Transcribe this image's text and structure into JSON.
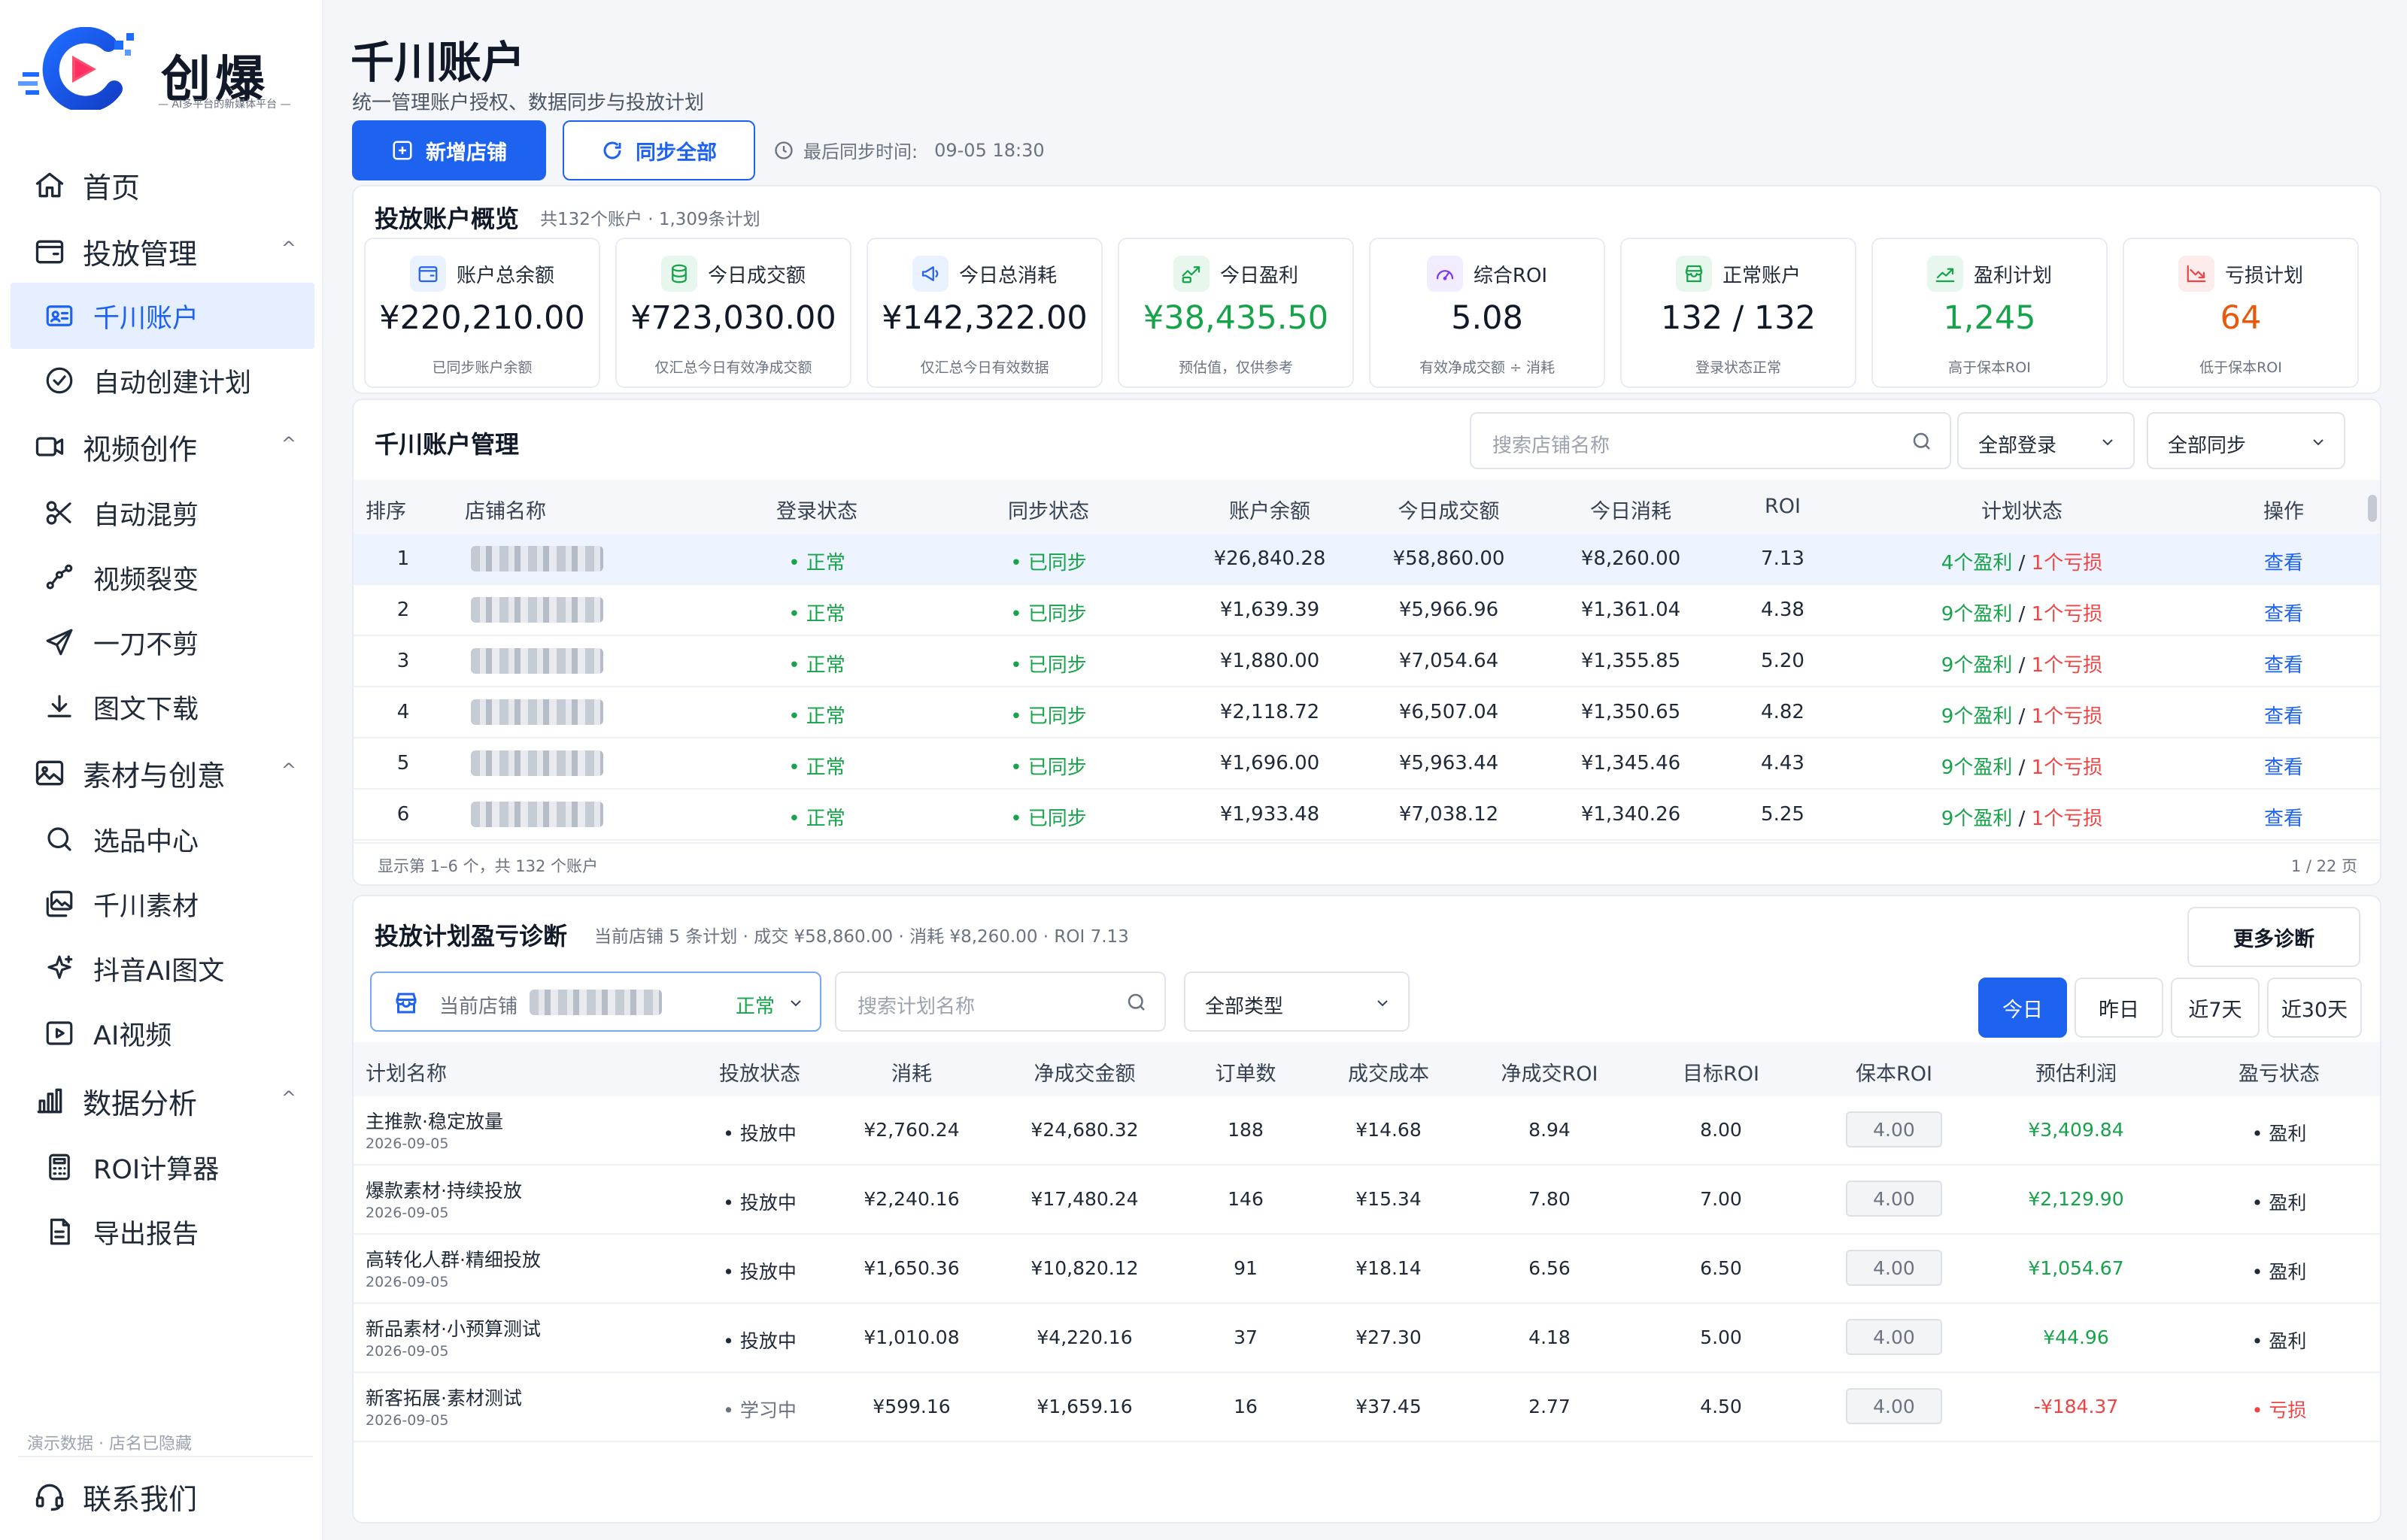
{
  "brand": {
    "name": "创爆",
    "slogan": "— AI多平台的新媒体平台 —"
  },
  "sidebar": {
    "items": [
      {
        "label": "首页",
        "icon": "home-icon"
      },
      {
        "label": "投放管理",
        "icon": "wallet-icon",
        "arrow": "^"
      },
      {
        "label": "千川账户",
        "icon": "account-card-icon",
        "active": true
      },
      {
        "label": "自动创建计划",
        "icon": "check-circle-icon"
      },
      {
        "label": "视频创作",
        "icon": "video-camera-icon",
        "arrow": "^"
      },
      {
        "label": "自动混剪",
        "icon": "scissors-icon"
      },
      {
        "label": "视频裂变",
        "icon": "fork-icon"
      },
      {
        "label": "一刀不剪",
        "icon": "send-icon"
      },
      {
        "label": "图文下载",
        "icon": "download-icon"
      },
      {
        "label": "素材与创意",
        "icon": "image-icon",
        "arrow": "^"
      },
      {
        "label": "选品中心",
        "icon": "search-icon"
      },
      {
        "label": "千川素材",
        "icon": "images-icon"
      },
      {
        "label": "抖音AI图文",
        "icon": "sparkle-icon"
      },
      {
        "label": "AI视频",
        "icon": "play-box-icon"
      },
      {
        "label": "数据分析",
        "icon": "bar-chart-icon",
        "arrow": "^"
      },
      {
        "label": "ROI计算器",
        "icon": "calculator-icon"
      },
      {
        "label": "导出报告",
        "icon": "file-icon"
      }
    ],
    "note": "演示数据 · 店名已隐藏",
    "contact": "联系我们"
  },
  "header": {
    "title": "千川账户",
    "subtitle": "统一管理账户授权、数据同步与投放计划",
    "add_button": "新增店铺",
    "sync_button": "同步全部",
    "sync_label": "最后同步时间:",
    "sync_time": "09-05 18:30"
  },
  "overview": {
    "title": "投放账户概览",
    "meta": "共132个账户 · 1,309条计划",
    "stats": [
      {
        "label": "账户总余额",
        "value": "¥220,210.00",
        "hint": "已同步账户余额",
        "icon": "wallet-icon",
        "color": "#2563eb",
        "bg": "#eaf1ff"
      },
      {
        "label": "今日成交额",
        "value": "¥723,030.00",
        "hint": "仅汇总今日有效净成交额",
        "icon": "coins-icon",
        "color": "#16a34a",
        "bg": "#e7f7ee"
      },
      {
        "label": "今日总消耗",
        "value": "¥142,322.00",
        "hint": "仅汇总今日有效数据",
        "icon": "megaphone-icon",
        "color": "#2563eb",
        "bg": "#eaf1ff"
      },
      {
        "label": "今日盈利",
        "value": "¥38,435.50",
        "hint": "预估值，仅供参考",
        "icon": "money-icon",
        "color": "#16a34a",
        "bg": "#e7f7ee",
        "valueColor": "#16a34a"
      },
      {
        "label": "综合ROI",
        "value": "5.08",
        "hint": "有效净成交额 ÷ 消耗",
        "icon": "gauge-icon",
        "color": "#7c3aed",
        "bg": "#f1ecff"
      },
      {
        "label": "正常账户",
        "value": "132 / 132",
        "hint": "登录状态正常",
        "icon": "store-icon",
        "color": "#16a34a",
        "bg": "#e7f7ee"
      },
      {
        "label": "盈利计划",
        "value": "1,245",
        "hint": "高于保本ROI",
        "icon": "trend-up-icon",
        "color": "#16a34a",
        "bg": "#e7f7ee",
        "valueColor": "#16a34a"
      },
      {
        "label": "亏损计划",
        "value": "64",
        "hint": "低于保本ROI",
        "icon": "trend-down-icon",
        "color": "#ef4444",
        "bg": "#fdecec",
        "valueColor": "#ea580c"
      }
    ]
  },
  "accounts": {
    "title": "千川账户管理",
    "search_placeholder": "搜索店铺名称",
    "filter_login": "全部登录",
    "filter_sync": "全部同步",
    "columns": [
      "排序",
      "店铺名称",
      "登录状态",
      "同步状态",
      "账户余额",
      "今日成交额",
      "今日消耗",
      "ROI",
      "计划状态",
      "操作"
    ],
    "rows": [
      {
        "rank": "1",
        "login": "正常",
        "sync": "已同步",
        "balance": "¥26,840.28",
        "gmv": "¥58,860.00",
        "cost": "¥8,260.00",
        "roi": "7.13",
        "profit": "4个盈利",
        "loss": "1个亏损",
        "action": "查看"
      },
      {
        "rank": "2",
        "login": "正常",
        "sync": "已同步",
        "balance": "¥1,639.39",
        "gmv": "¥5,966.96",
        "cost": "¥1,361.04",
        "roi": "4.38",
        "profit": "9个盈利",
        "loss": "1个亏损",
        "action": "查看"
      },
      {
        "rank": "3",
        "login": "正常",
        "sync": "已同步",
        "balance": "¥1,880.00",
        "gmv": "¥7,054.64",
        "cost": "¥1,355.85",
        "roi": "5.20",
        "profit": "9个盈利",
        "loss": "1个亏损",
        "action": "查看"
      },
      {
        "rank": "4",
        "login": "正常",
        "sync": "已同步",
        "balance": "¥2,118.72",
        "gmv": "¥6,507.04",
        "cost": "¥1,350.65",
        "roi": "4.82",
        "profit": "9个盈利",
        "loss": "1个亏损",
        "action": "查看"
      },
      {
        "rank": "5",
        "login": "正常",
        "sync": "已同步",
        "balance": "¥1,696.00",
        "gmv": "¥5,963.44",
        "cost": "¥1,345.46",
        "roi": "4.43",
        "profit": "9个盈利",
        "loss": "1个亏损",
        "action": "查看"
      },
      {
        "rank": "6",
        "login": "正常",
        "sync": "已同步",
        "balance": "¥1,933.48",
        "gmv": "¥7,038.12",
        "cost": "¥1,340.26",
        "roi": "5.25",
        "profit": "9个盈利",
        "loss": "1个亏损",
        "action": "查看"
      }
    ],
    "footer_left": "显示第 1–6 个，共 132 个账户",
    "footer_right": "1 / 22 页"
  },
  "plans": {
    "title": "投放计划盈亏诊断",
    "meta": "当前店铺 5 条计划 · 成交 ¥58,860.00 · 消耗 ¥8,260.00 · ROI 7.13",
    "more_button": "更多诊断",
    "store_label": "当前店铺",
    "store_status": "正常",
    "search_placeholder": "搜索计划名称",
    "type_filter": "全部类型",
    "tabs": [
      "今日",
      "昨日",
      "近7天",
      "近30天"
    ],
    "columns": [
      "计划名称",
      "投放状态",
      "消耗",
      "净成交金额",
      "订单数",
      "成交成本",
      "净成交ROI",
      "目标ROI",
      "保本ROI",
      "预估利润",
      "盈亏状态"
    ],
    "rows": [
      {
        "name": "主推款·稳定放量",
        "date": "2026-09-05",
        "status": "投放中",
        "cost": "¥2,760.24",
        "gmv": "¥24,680.32",
        "orders": "188",
        "cpo": "¥14.68",
        "roi": "8.94",
        "target": "8.00",
        "breakeven": "4.00",
        "profit": "¥3,409.84",
        "result": "盈利"
      },
      {
        "name": "爆款素材·持续投放",
        "date": "2026-09-05",
        "status": "投放中",
        "cost": "¥2,240.16",
        "gmv": "¥17,480.24",
        "orders": "146",
        "cpo": "¥15.34",
        "roi": "7.80",
        "target": "7.00",
        "breakeven": "4.00",
        "profit": "¥2,129.90",
        "result": "盈利"
      },
      {
        "name": "高转化人群·精细投放",
        "date": "2026-09-05",
        "status": "投放中",
        "cost": "¥1,650.36",
        "gmv": "¥10,820.12",
        "orders": "91",
        "cpo": "¥18.14",
        "roi": "6.56",
        "target": "6.50",
        "breakeven": "4.00",
        "profit": "¥1,054.67",
        "result": "盈利"
      },
      {
        "name": "新品素材·小预算测试",
        "date": "2026-09-05",
        "status": "投放中",
        "cost": "¥1,010.08",
        "gmv": "¥4,220.16",
        "orders": "37",
        "cpo": "¥27.30",
        "roi": "4.18",
        "target": "5.00",
        "breakeven": "4.00",
        "profit": "¥44.96",
        "result": "盈利"
      },
      {
        "name": "新客拓展·素材测试",
        "date": "2026-09-05",
        "status": "学习中",
        "cost": "¥599.16",
        "gmv": "¥1,659.16",
        "orders": "16",
        "cpo": "¥37.45",
        "roi": "2.77",
        "target": "4.50",
        "breakeven": "4.00",
        "profit": "-¥184.37",
        "result": "亏损"
      }
    ]
  },
  "colors": {
    "primary": "#1d63ef",
    "success": "#16a34a",
    "danger": "#ef4444"
  }
}
